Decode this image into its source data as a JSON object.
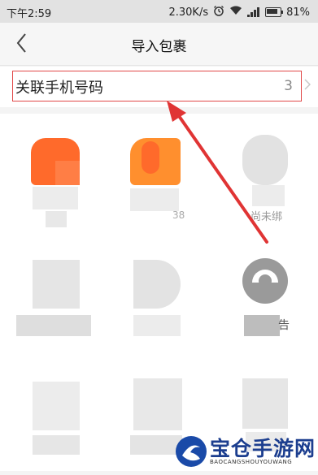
{
  "status_bar": {
    "time": "下午2:59",
    "speed": "2.30K/s",
    "battery": "81%"
  },
  "nav": {
    "title": "导入包裹"
  },
  "link_row": {
    "label": "关联手机号码",
    "count": "3"
  },
  "contacts_visible_fragments": [
    "38",
    "尚未绑",
    "告"
  ],
  "watermark": {
    "title": "宝仓手游网",
    "subtitle": "BAOCANGSHOUYOUWANG"
  },
  "colors": {
    "highlight": "#e14848",
    "arrow": "#e03434",
    "accent_orange": "#ff6a2b"
  }
}
